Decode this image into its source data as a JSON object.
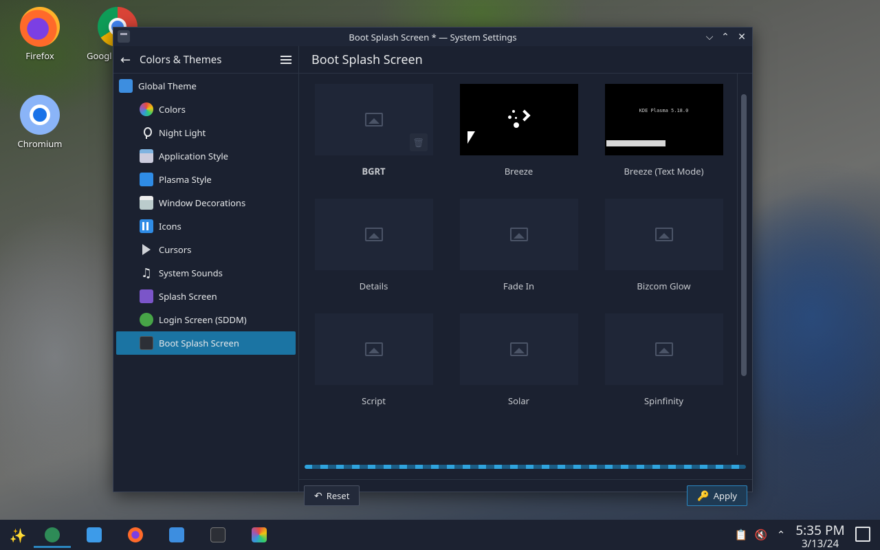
{
  "desktop": {
    "icons": [
      {
        "label": "Firefox"
      },
      {
        "label": "Googl"
      },
      {
        "label": "Chromium"
      }
    ]
  },
  "window": {
    "title": "Boot Splash Screen * — System Settings",
    "controls": {
      "minimize": "⌵",
      "maximize": "⌃",
      "close": "✕"
    }
  },
  "sidebar": {
    "title": "Colors & Themes",
    "items": [
      {
        "label": "Global Theme"
      },
      {
        "label": "Colors"
      },
      {
        "label": "Night Light"
      },
      {
        "label": "Application Style"
      },
      {
        "label": "Plasma Style"
      },
      {
        "label": "Window Decorations"
      },
      {
        "label": "Icons"
      },
      {
        "label": "Cursors"
      },
      {
        "label": "System Sounds"
      },
      {
        "label": "Splash Screen"
      },
      {
        "label": "Login Screen (SDDM)"
      },
      {
        "label": "Boot Splash Screen"
      }
    ],
    "selected_index": 11
  },
  "content": {
    "title": "Boot Splash Screen",
    "themes": [
      {
        "label": "BGRT"
      },
      {
        "label": "Breeze"
      },
      {
        "label": "Breeze (Text Mode)"
      },
      {
        "label": "Details"
      },
      {
        "label": "Fade In"
      },
      {
        "label": "Bizcom Glow"
      },
      {
        "label": "Script"
      },
      {
        "label": "Solar"
      },
      {
        "label": "Spinfinity"
      }
    ],
    "text_mode_preview_title": "KDE Plasma 5.18.0",
    "reset_label": "Reset",
    "apply_label": "Apply"
  },
  "taskbar": {
    "time": "5:35 PM",
    "date": "3/13/24"
  },
  "colors": {
    "accent": "#1b74a3",
    "window_bg": "#1b2130",
    "taskbar_bg": "#1c2231"
  }
}
